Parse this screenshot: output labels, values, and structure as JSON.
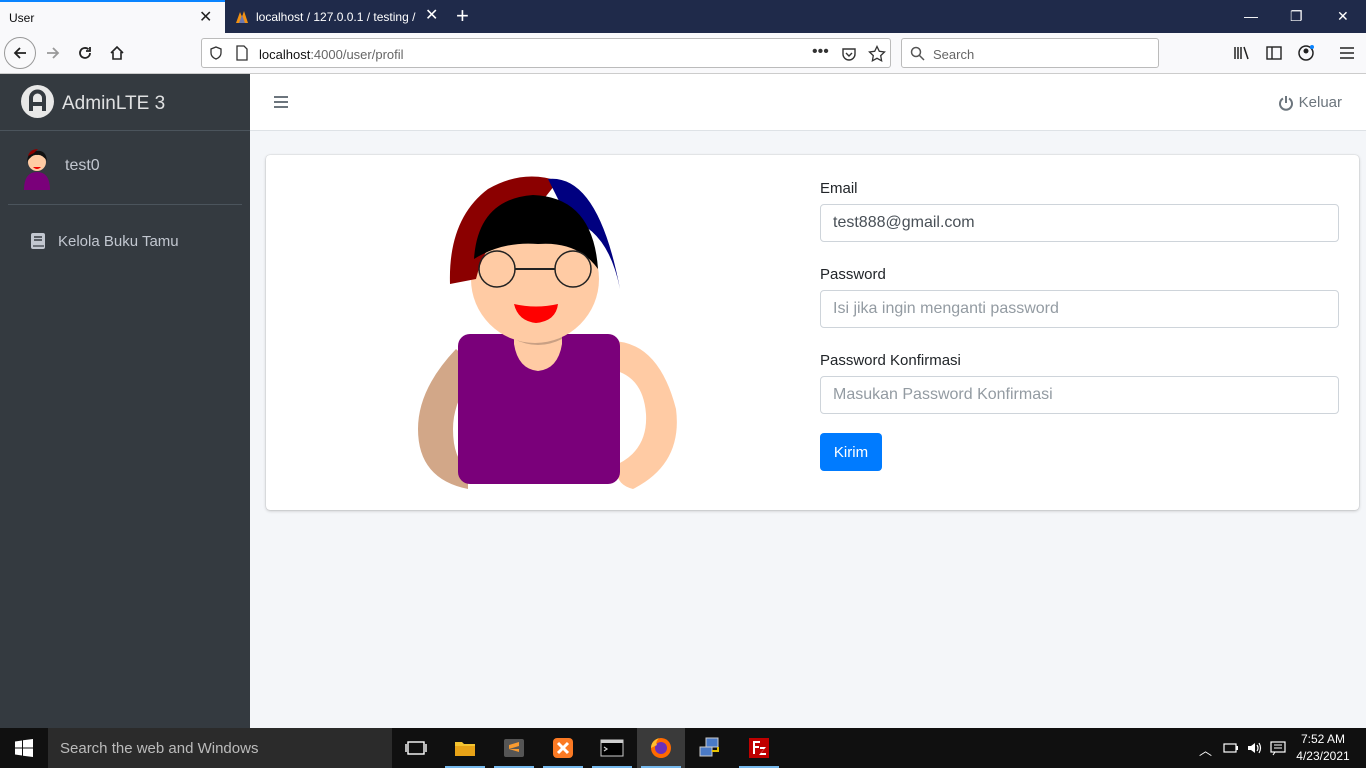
{
  "browser": {
    "tabs": [
      {
        "title": "User",
        "active": true
      },
      {
        "title": "localhost / 127.0.0.1 / testing / ...",
        "active": false
      }
    ],
    "url_host": "localhost",
    "url_path": ":4000/user/profil",
    "search_placeholder": "Search"
  },
  "sidebar": {
    "brand": "AdminLTE 3",
    "user_name": "test0",
    "items": [
      {
        "label": "Kelola Buku Tamu",
        "icon": "book-icon"
      }
    ]
  },
  "header": {
    "logout_label": "Keluar"
  },
  "form": {
    "email_label": "Email",
    "email_value": "test888@gmail.com",
    "password_label": "Password",
    "password_placeholder": "Isi jika ingin menganti password",
    "confirm_label": "Password Konfirmasi",
    "confirm_placeholder": "Masukan Password Konfirmasi",
    "submit_label": "Kirim"
  },
  "taskbar": {
    "search_placeholder": "Search the web and Windows",
    "time": "7:52 AM",
    "date": "4/23/2021"
  },
  "colors": {
    "accent": "#007bff",
    "sidebar_bg": "#343a40",
    "shirt": "#7a007a",
    "hat_red": "#8b0000",
    "hat_blue": "#000080",
    "skin": "#ffcba4"
  }
}
